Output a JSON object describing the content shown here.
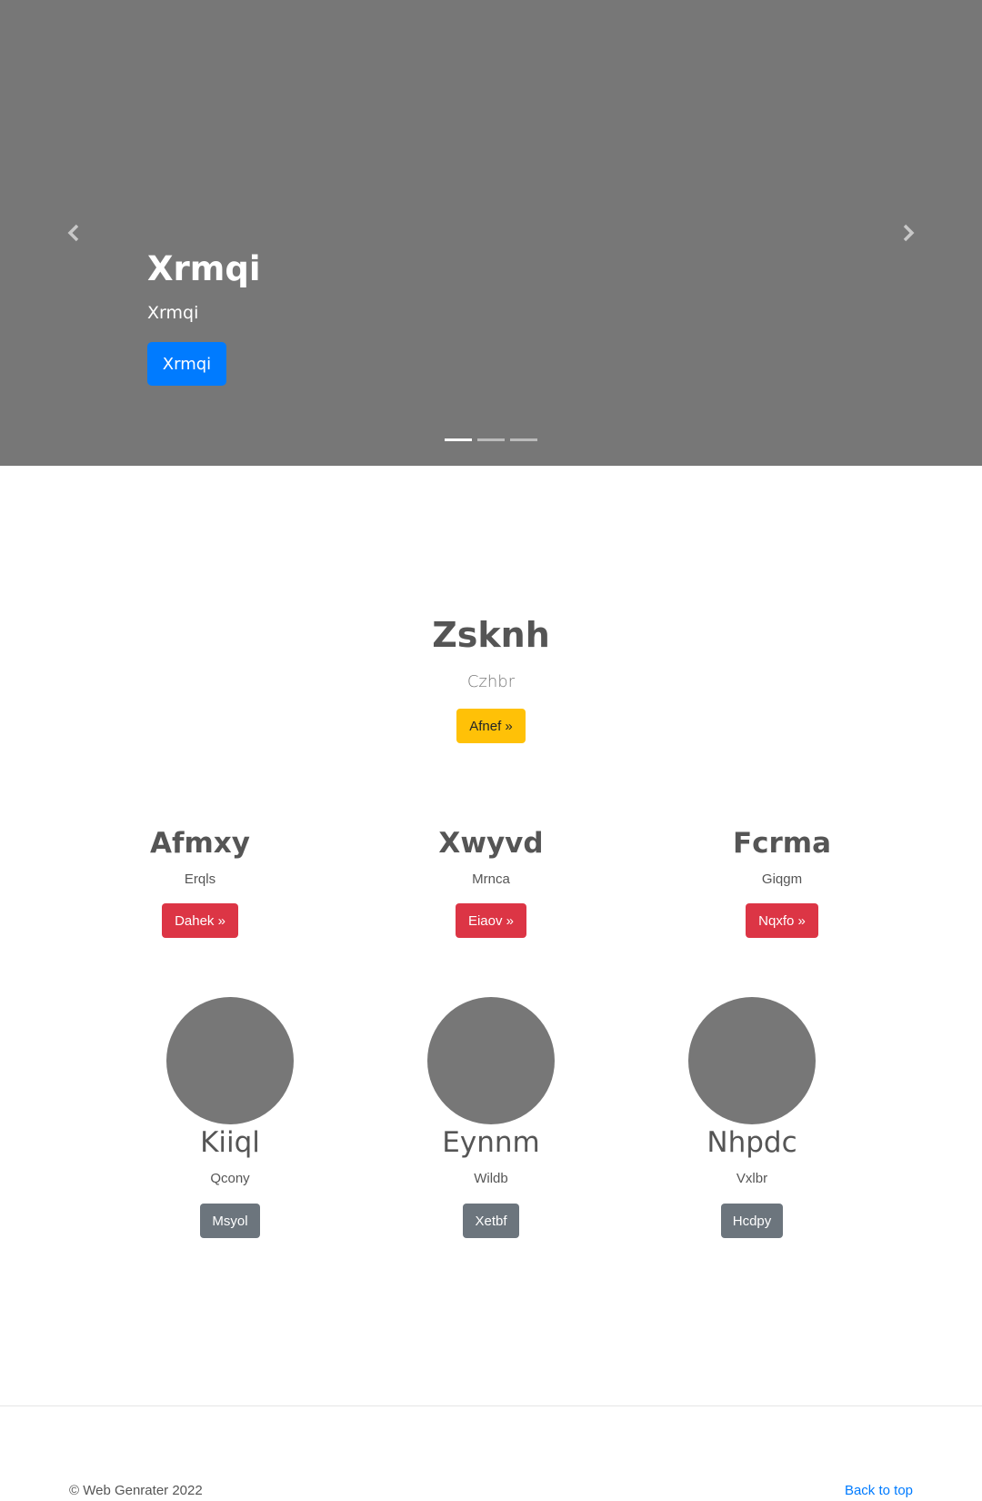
{
  "carousel": {
    "slide_title": "Xrmqi",
    "slide_text": "Xrmqi",
    "slide_button": "Xrmqi",
    "prev_icon": "chevron-left-icon",
    "next_icon": "chevron-right-icon",
    "slide_count": 3,
    "active_slide": 1
  },
  "featured": {
    "title": "Zsknh",
    "subtitle": "Czhbr",
    "button": "Afnef »"
  },
  "columns": [
    {
      "title": "Afmxy",
      "text": "Erqls",
      "button": "Dahek »"
    },
    {
      "title": "Xwyvd",
      "text": "Mrnca",
      "button": "Eiaov »"
    },
    {
      "title": "Fcrma",
      "text": "Giqgm",
      "button": "Nqxfo »"
    }
  ],
  "cards": [
    {
      "title": "Kiiql",
      "text": "Qcony",
      "button": "Msyol"
    },
    {
      "title": "Eynnm",
      "text": "Wildb",
      "button": "Xetbf"
    },
    {
      "title": "Nhpdc",
      "text": "Vxlbr",
      "button": "Hcdpy"
    }
  ],
  "footer": {
    "copyright": "© Web Genrater 2022",
    "back_to_top": "Back to top"
  },
  "colors": {
    "primary": "#007bff",
    "warning": "#ffc107",
    "danger": "#dc3545",
    "secondary": "#6c757d",
    "placeholder": "#777777"
  }
}
